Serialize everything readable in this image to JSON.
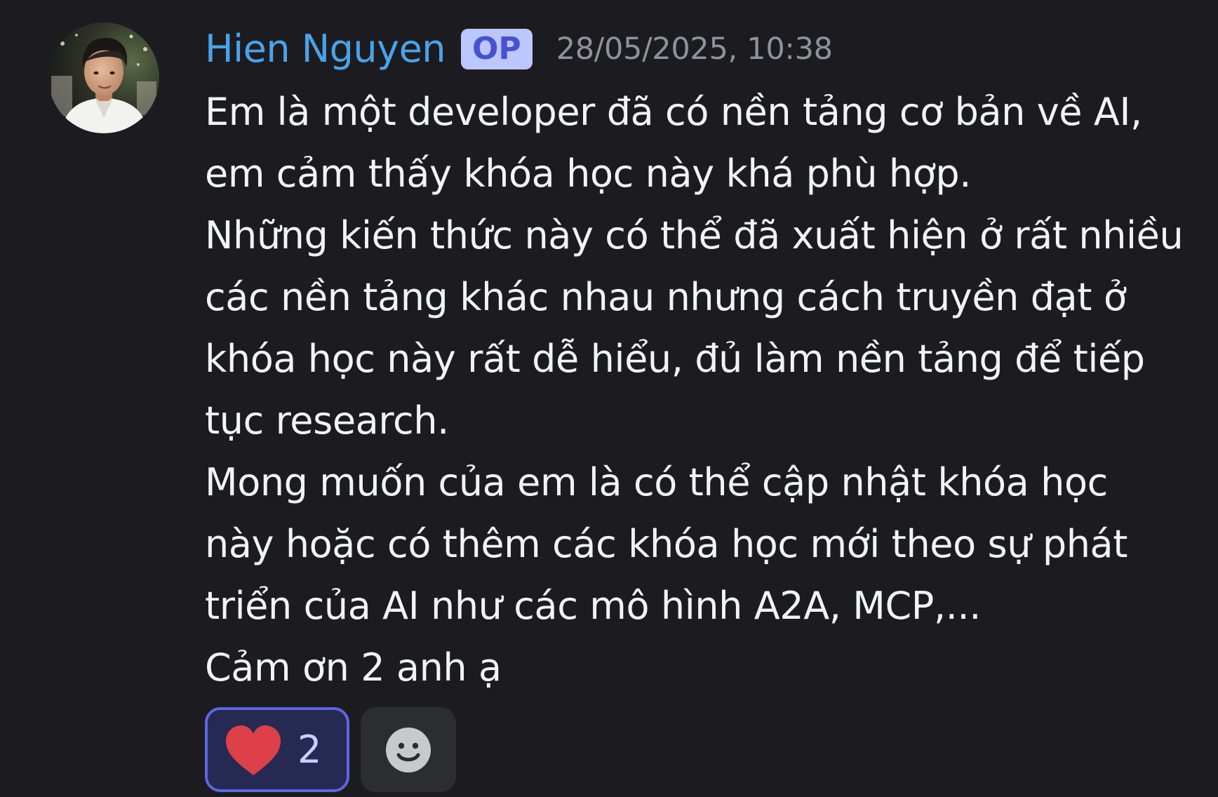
{
  "message": {
    "author": "Hien Nguyen",
    "badge": "OP",
    "timestamp": "28/05/2025, 10:38",
    "lines": [
      "Em là một developer đã có nền tảng cơ bản về AI,",
      "em cảm thấy khóa học này khá phù hợp.",
      "Những kiến thức này có thể đã xuất hiện ở rất nhiều",
      "các nền tảng khác nhau nhưng cách truyền đạt ở",
      "khóa học này rất dễ hiểu, đủ làm nền tảng để tiếp",
      "tục research.",
      "Mong muốn của em là có thể cập nhật khóa học",
      "này hoặc có thêm các khóa học mới theo sự phát",
      "triển của AI như các mô hình A2A, MCP,...",
      "Cảm ơn 2 anh ạ"
    ]
  },
  "reactions": [
    {
      "icon": "heart-icon",
      "count": "2",
      "selected": true
    }
  ],
  "add_reaction_icon": "smiley-icon",
  "colors": {
    "background": "#1c1c20",
    "username": "#4aa3e8",
    "badge_background": "#bcc6ff",
    "badge_text": "#4552d1",
    "timestamp": "#8f929a",
    "content_text": "#f2f3f5",
    "reaction_background": "#262a52",
    "reaction_border": "#5d66e3",
    "reaction_count": "#c9d0ff",
    "heart": "#dd4049",
    "add_reaction_background": "#2b2d31",
    "smiley": "#c7c9cc"
  }
}
